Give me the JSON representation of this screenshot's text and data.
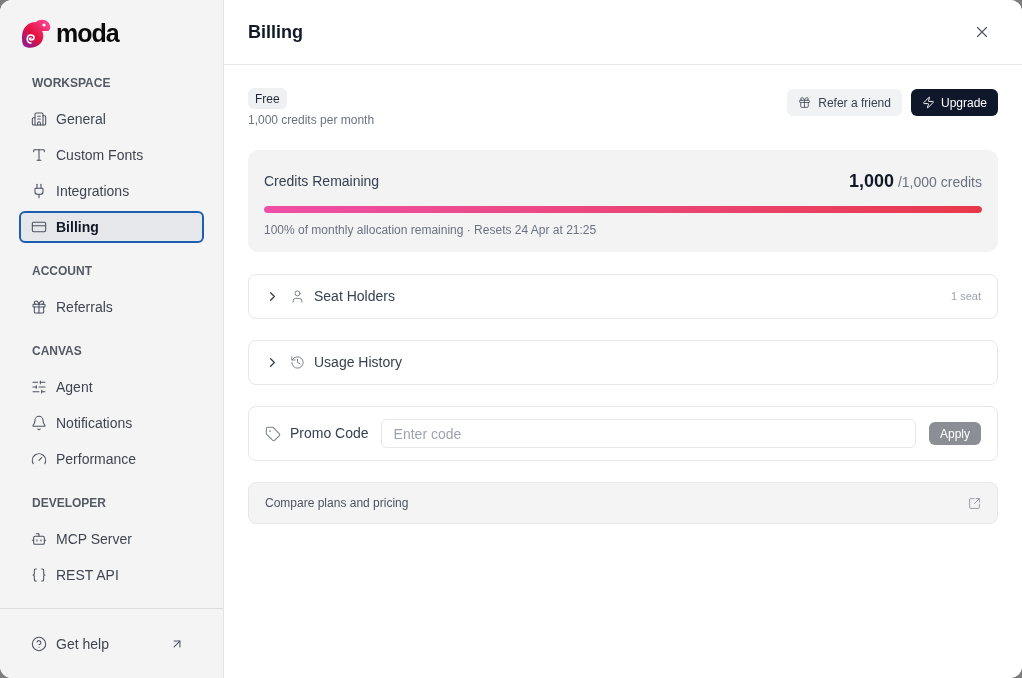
{
  "brand": {
    "name": "moda"
  },
  "sidebar": {
    "sections": [
      {
        "heading": "WORKSPACE",
        "items": [
          {
            "label": "General",
            "selected": false
          },
          {
            "label": "Custom Fonts",
            "selected": false
          },
          {
            "label": "Integrations",
            "selected": false
          },
          {
            "label": "Billing",
            "selected": true
          }
        ]
      },
      {
        "heading": "ACCOUNT",
        "items": [
          {
            "label": "Referrals",
            "selected": false
          }
        ]
      },
      {
        "heading": "CANVAS",
        "items": [
          {
            "label": "Agent",
            "selected": false
          },
          {
            "label": "Notifications",
            "selected": false
          },
          {
            "label": "Performance",
            "selected": false
          }
        ]
      },
      {
        "heading": "DEVELOPER",
        "items": [
          {
            "label": "MCP Server",
            "selected": false
          },
          {
            "label": "REST API",
            "selected": false
          }
        ]
      }
    ],
    "footer": {
      "label": "Get help"
    }
  },
  "header": {
    "title": "Billing"
  },
  "plan": {
    "badge": "Free",
    "allowance": "1,000 credits per month"
  },
  "actions": [
    {
      "label": "Refer a friend",
      "kind": "secondary"
    },
    {
      "label": "Upgrade",
      "kind": "primary"
    }
  ],
  "credits": {
    "title": "Credits Remaining",
    "amount": "1,000",
    "total": "/1,000 credits",
    "level": 1,
    "note": "100% of monthly allocation remaining · Resets 24 Apr at 21:25"
  },
  "sections": [
    {
      "title": "Seat Holders",
      "meta": "1 seat",
      "expanded": false
    },
    {
      "title": "Usage History",
      "expanded": false
    }
  ],
  "promo": {
    "label": "Promo Code",
    "placeholder": "Enter code",
    "button": {
      "label": "Apply",
      "disabled": true
    }
  },
  "compare": {
    "label": "Compare plans and pricing"
  }
}
